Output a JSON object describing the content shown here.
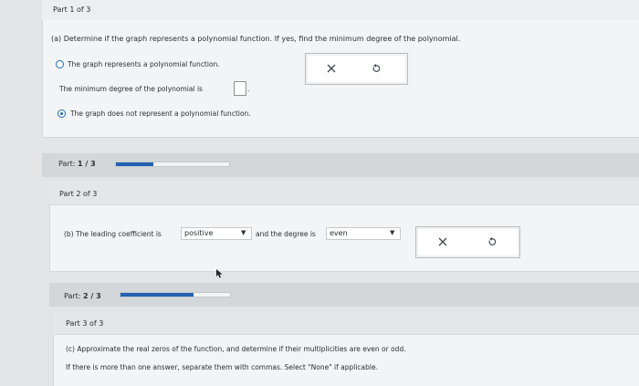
{
  "part1": {
    "header": "Part 1 of 3",
    "question": "(a) Determine if the graph represents a polynomial function. If yes, find the minimum degree of the polynomial.",
    "option1_label": "The graph represents a polynomial function.",
    "min_degree_label": "The minimum degree of the polynomial is",
    "min_degree_value": "",
    "option2_label": "The graph does not represent a polynomial function.",
    "selected_option": 2,
    "progress_label": "Part:",
    "progress_value": "1 / 3",
    "progress_fraction": 0.333
  },
  "part2": {
    "header": "Part 2 of 3",
    "question_prefix": "(b) The leading coefficient is",
    "leading_coefficient": "positive",
    "question_middle": "and the degree is",
    "degree_parity": "even",
    "progress_label": "Part:",
    "progress_value": "2 / 3",
    "progress_fraction": 0.667
  },
  "part3": {
    "header": "Part 3 of 3",
    "question": "(c) Approximate the real zeros of the function, and determine if their multiplicities are even or odd.",
    "instructions": "If there is more than one answer, separate them with commas. Select \"None\" if applicable."
  },
  "icons": {
    "clear": "close-icon",
    "undo": "undo-icon",
    "dropdown": "caret-down-icon"
  },
  "colors": {
    "accent": "#2161b1",
    "radio": "#1c6bb5"
  }
}
